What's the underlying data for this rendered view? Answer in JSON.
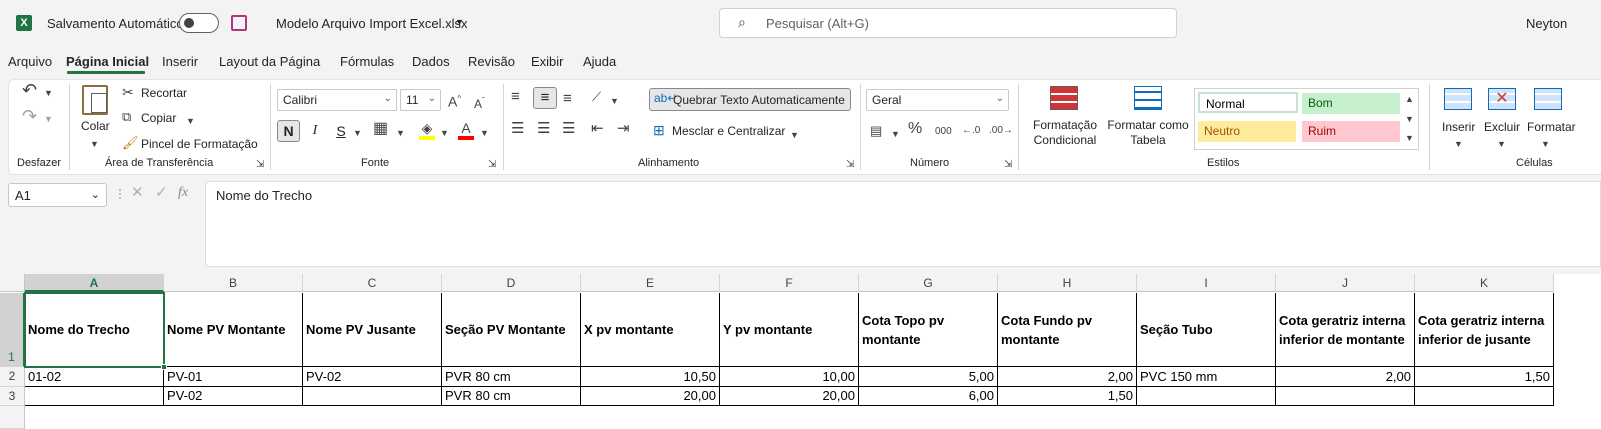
{
  "titlebar": {
    "autosave_label": "Salvamento Automático",
    "autosave_state": "off",
    "file_name": "Modelo Arquivo Import Excel.xlsx",
    "search_placeholder": "Pesquisar (Alt+G)",
    "user_name": "Neyton"
  },
  "menu": [
    "Arquivo",
    "Página Inicial",
    "Inserir",
    "Layout da Página",
    "Fórmulas",
    "Dados",
    "Revisão",
    "Exibir",
    "Ajuda"
  ],
  "ribbon": {
    "groups": {
      "undo": "Desfazer",
      "clipboard": "Área de Transferência",
      "font": "Fonte",
      "alignment": "Alinhamento",
      "number": "Número",
      "styles": "Estilos",
      "cells": "Células"
    },
    "clipboard": {
      "paste": "Colar",
      "cut": "Recortar",
      "copy": "Copiar",
      "format_painter": "Pincel de Formatação"
    },
    "font": {
      "name": "Calibri",
      "size": "11",
      "bold": "N",
      "italic": "I",
      "underline": "S"
    },
    "alignment": {
      "wrap": "Quebrar Texto Automaticamente",
      "merge": "Mesclar e Centralizar"
    },
    "number": {
      "format": "Geral"
    },
    "styles": {
      "conditional": "Formatação Condicional",
      "as_table": "Formatar como Tabela",
      "normal": "Normal",
      "good": "Bom",
      "neutral": "Neutro",
      "bad": "Ruim"
    },
    "cells": {
      "insert": "Inserir",
      "delete": "Excluir",
      "format": "Formatar"
    }
  },
  "formula_bar": {
    "name_box": "A1",
    "content": "Nome do Trecho"
  },
  "sheet": {
    "columns": [
      "A",
      "B",
      "C",
      "D",
      "E",
      "F",
      "G",
      "H",
      "I",
      "J",
      "K"
    ],
    "rows": [
      "1",
      "2",
      "3"
    ],
    "header": [
      "Nome do Trecho",
      "Nome PV Montante",
      "Nome PV Jusante",
      "Seção PV Montante",
      "X pv montante",
      "Y pv montante",
      "Cota Topo pv montante",
      "Cota Fundo pv montante",
      "Seção Tubo",
      "Cota geratriz interna inferior de montante",
      "Cota geratriz interna inferior de jusante"
    ],
    "data": [
      [
        "01-02",
        "PV-01",
        "PV-02",
        "PVR 80 cm",
        "10,50",
        "10,00",
        "5,00",
        "2,00",
        "PVC 150 mm",
        "2,00",
        "1,50"
      ],
      [
        "",
        "PV-02",
        "",
        "PVR 80 cm",
        "20,00",
        "20,00",
        "6,00",
        "1,50",
        "",
        "",
        ""
      ]
    ]
  },
  "colors": {
    "accent": "#217346",
    "good_bg": "#c6efce",
    "good_fg": "#006100",
    "neutral_bg": "#ffeb9c",
    "neutral_fg": "#9c5700",
    "bad_bg": "#ffc7ce",
    "bad_fg": "#9c0006"
  }
}
